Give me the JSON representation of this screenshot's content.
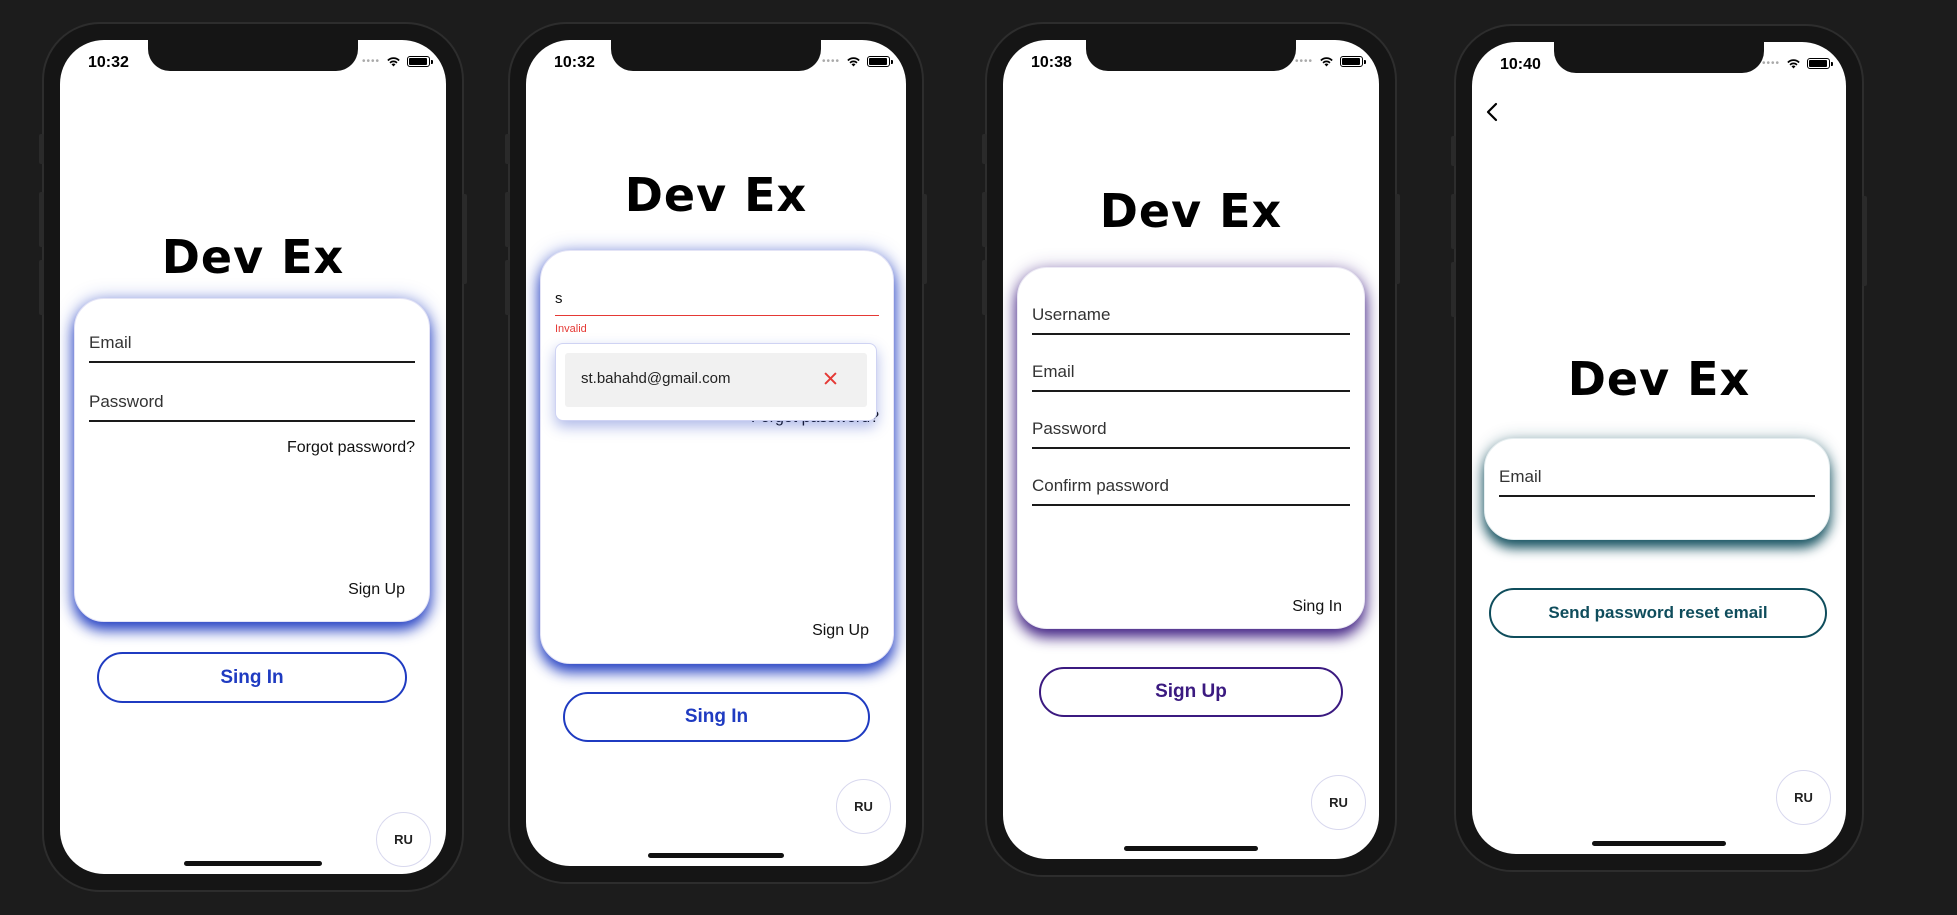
{
  "app": {
    "title": "Dev Ex",
    "language_button": "RU"
  },
  "colors": {
    "blue": "#1f3bc1",
    "purple": "#3b1a80",
    "teal": "#0f4d5c",
    "error": "#e53935"
  },
  "screens": [
    {
      "name": "sign-in",
      "time": "10:32",
      "fields": [
        "Email",
        "Password"
      ],
      "forgot_password": "Forgot password?",
      "switch_link": "Sign Up",
      "primary_button": "Sing In"
    },
    {
      "name": "sign-in-autofill",
      "time": "10:32",
      "email_value": "s",
      "error_text": "Invalid",
      "suggestion": "st.bahahd@gmail.com",
      "forgot_password_partial": "Forgot password?",
      "switch_link": "Sign Up",
      "primary_button": "Sing In"
    },
    {
      "name": "sign-up",
      "time": "10:38",
      "fields": [
        "Username",
        "Email",
        "Password",
        "Confirm password"
      ],
      "switch_link": "Sing In",
      "primary_button": "Sign Up"
    },
    {
      "name": "reset-password",
      "time": "10:40",
      "fields": [
        "Email"
      ],
      "primary_button": "Send password reset email"
    }
  ]
}
